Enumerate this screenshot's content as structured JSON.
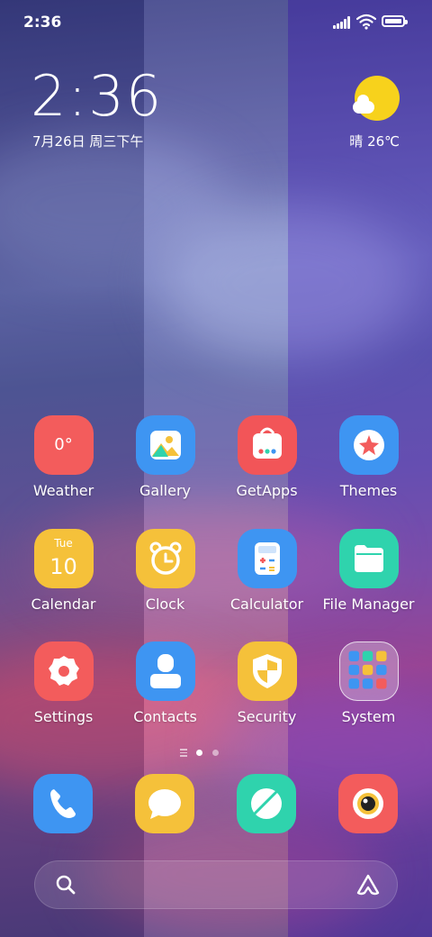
{
  "status_bar": {
    "time": "2:36"
  },
  "lockscreen_clock": {
    "time": "2:36",
    "date": "7月26日 周三下午"
  },
  "weather_widget": {
    "text": "晴 26℃",
    "icon": "sunny-partly-cloudy-icon"
  },
  "apps": [
    {
      "label": "Weather",
      "icon": "weather-icon",
      "color": "#f35c5c",
      "text": "0°"
    },
    {
      "label": "Gallery",
      "icon": "gallery-icon",
      "color": "#3e95f2"
    },
    {
      "label": "GetApps",
      "icon": "shopping-bag-icon",
      "color": "#f25558"
    },
    {
      "label": "Themes",
      "icon": "themes-icon",
      "color": "#3e95f2"
    },
    {
      "label": "Calendar",
      "icon": "calendar-icon",
      "color": "#f5c13a",
      "day": "Tue",
      "date": "10"
    },
    {
      "label": "Clock",
      "icon": "alarm-clock-icon",
      "color": "#f5c13a"
    },
    {
      "label": "Calculator",
      "icon": "calculator-icon",
      "color": "#3e95f2"
    },
    {
      "label": "File Manager",
      "icon": "folder-icon",
      "color": "#2fd3ad"
    },
    {
      "label": "Settings",
      "icon": "gear-icon",
      "color": "#f35c5c"
    },
    {
      "label": "Contacts",
      "icon": "contacts-icon",
      "color": "#3e95f2"
    },
    {
      "label": "Security",
      "icon": "shield-icon",
      "color": "#f5c13a"
    },
    {
      "label": "System",
      "icon": "folder-grid-icon",
      "color": "rgba(255,255,255,0.25)"
    }
  ],
  "dock": [
    {
      "name": "phone",
      "icon": "phone-icon",
      "color": "#3e95f2"
    },
    {
      "name": "messages",
      "icon": "message-bubble-icon",
      "color": "#f5c13a"
    },
    {
      "name": "browser",
      "icon": "browser-icon",
      "color": "#2fd3ad"
    },
    {
      "name": "camera",
      "icon": "camera-icon",
      "color": "#f35c5c"
    }
  ],
  "page_indicator": {
    "count": 2,
    "active": 1
  }
}
